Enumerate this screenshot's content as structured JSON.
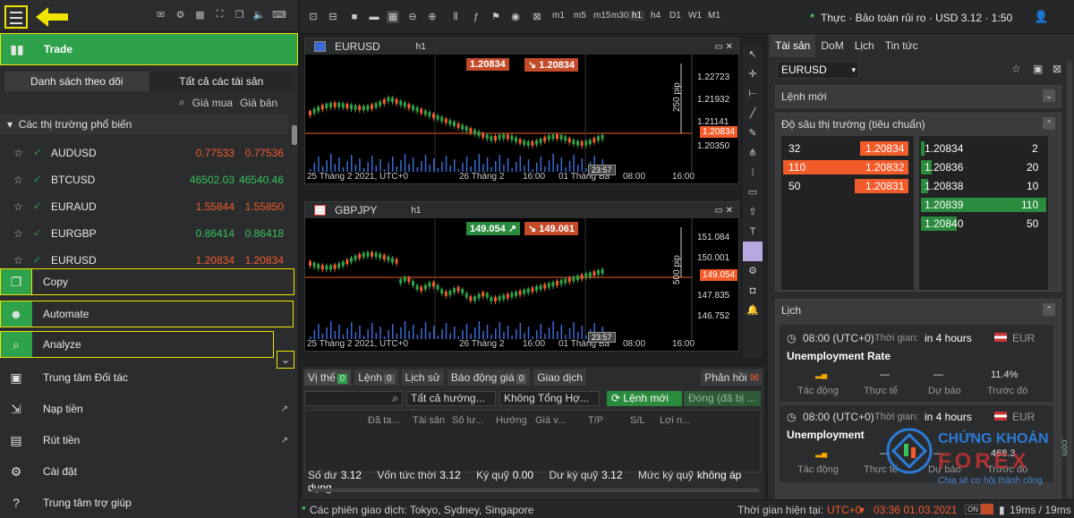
{
  "sidebar": {
    "trade": "Trade",
    "tabs": [
      "Danh sách theo dõi",
      "Tất cả các tài sản"
    ],
    "cols": {
      "bid": "Giá mua",
      "ask": "Giá bán"
    },
    "group": "Các thị trường phổ biến",
    "symbols": [
      {
        "name": "AUDUSD",
        "bid": "0.77533",
        "ask": "0.77536",
        "bidc": "red",
        "askc": "red"
      },
      {
        "name": "BTCUSD",
        "bid": "46502.03",
        "ask": "46540.46",
        "bidc": "grn",
        "askc": "grn"
      },
      {
        "name": "EURAUD",
        "bid": "1.55844",
        "ask": "1.55850",
        "bidc": "red",
        "askc": "red"
      },
      {
        "name": "EURGBP",
        "bid": "0.86414",
        "ask": "0.86418",
        "bidc": "grn",
        "askc": "grn"
      },
      {
        "name": "EURUSD",
        "bid": "1.20834",
        "ask": "1.20834",
        "bidc": "red",
        "askc": "red"
      }
    ],
    "menu": {
      "copy": "Copy",
      "automate": "Automate",
      "analyze": "Analyze",
      "partner": "Trung tâm Đối tác",
      "deposit": "Nạp tiền",
      "withdraw": "Rút tiền",
      "settings": "Cài đặt",
      "help": "Trung tâm trợ giúp"
    }
  },
  "toolbar": {
    "timeframes": [
      "m1",
      "m5",
      "m15",
      "m30",
      "h1",
      "h4",
      "D1",
      "W1",
      "M1"
    ],
    "account": "Thực · Bảo toàn rủi ro · USD 3.12 · 1:50"
  },
  "chart1": {
    "symbol": "EURUSD",
    "tf": "h1",
    "sell": "1.20834",
    "buy": "1.20834",
    "prices": [
      "1.22723",
      "1.21932",
      "1.21141",
      "1.20834",
      "1.20350"
    ],
    "pips": "250 pip",
    "times": [
      "25 Tháng 2 2021, UTC+0",
      "26 Tháng 2",
      "16:00",
      "01 Tháng Ba",
      "08:00",
      "16:00"
    ],
    "clock": "23:57"
  },
  "chart2": {
    "symbol": "GBPJPY",
    "tf": "h1",
    "sell": "149.054",
    "buy": "149.061",
    "prices": [
      "151.084",
      "150.001",
      "149.054",
      "147.835",
      "146.752"
    ],
    "pips": "500 pip",
    "times": [
      "25 Tháng 2 2021, UTC+0",
      "26 Tháng 2",
      "16:00",
      "01 Tháng Ba",
      "08:00",
      "16:00"
    ],
    "clock": "23:57"
  },
  "positions": {
    "tabs": [
      {
        "l": "Vị thế",
        "c": "0"
      },
      {
        "l": "Lệnh",
        "c": "0"
      },
      {
        "l": "Lịch sử",
        "c": ""
      },
      {
        "l": "Báo động giá",
        "c": "0"
      },
      {
        "l": "Giao dịch",
        "c": ""
      }
    ],
    "feedback": "Phản hồi",
    "dir": "Tất cả hướng...",
    "type": "Không Tổng Hợ...",
    "new": "Lệnh mới",
    "close": "Đóng (đã bị ...",
    "cols": [
      "Đã ta...",
      "Tài sản",
      "Số lư...",
      "Hướng",
      "Giá v...",
      "T/P",
      "S/L",
      "Lợi n..."
    ],
    "summary": [
      {
        "l": "Số dư",
        "v": "3.12"
      },
      {
        "l": "Vốn tức thời",
        "v": "3.12"
      },
      {
        "l": "Ký quỹ",
        "v": "0.00"
      },
      {
        "l": "Dư ký quỹ",
        "v": "3.12"
      },
      {
        "l": "Mức ký quỹ",
        "v": "không áp dụng"
      }
    ]
  },
  "right": {
    "tabs": [
      "Tài sản",
      "DoM",
      "Lịch",
      "Tin tức"
    ],
    "instrument": "EURUSD",
    "new_order": "Lệnh mới",
    "depth": "Độ sâu thị trường (tiêu chuẩn)",
    "bids": [
      {
        "vol": "32",
        "price": "1.20834"
      },
      {
        "vol": "110",
        "price": "1.20832"
      },
      {
        "vol": "50",
        "price": "1.20831"
      }
    ],
    "asks": [
      {
        "price": "1.20834",
        "vol": "2"
      },
      {
        "price": "1.20836",
        "vol": "20"
      },
      {
        "price": "1.20838",
        "vol": "10"
      },
      {
        "price": "1.20839",
        "vol": "110"
      },
      {
        "price": "1.20840",
        "vol": "50"
      }
    ],
    "calendar": "Lịch",
    "events": [
      {
        "time": "08:00 (UTC+0)",
        "tlabel": "Thời gian:",
        "in": "in 4 hours",
        "cur": "EUR",
        "title": "Unemployment Rate",
        "labels": [
          "Tác động",
          "Thực tế",
          "Dự báo",
          "Trước đó"
        ],
        "values": [
          "",
          "—",
          "—",
          "11.4%"
        ]
      },
      {
        "time": "08:00 (UTC+0)",
        "tlabel": "Thời gian:",
        "in": "in 4 hours",
        "cur": "EUR",
        "title": "Unemployment",
        "labels": [
          "Tác động",
          "Thực tế",
          "Dự báo",
          "Trước đó"
        ],
        "values": [
          "",
          "—",
          "—",
          "468.3"
        ]
      }
    ]
  },
  "status": {
    "sessions": "Các phiên giao dịch: Tokyo, Sydney, Singapore",
    "now_label": "Thời gian hiện tại:",
    "tz": "UTC+0",
    "clock": "03:36 01.03.2021",
    "on": "ON",
    "latency": "19ms / 19ms"
  },
  "watermark": {
    "line1": "CHỨNG KHOÁN",
    "line2": "FOREX",
    "line3": "Chia sẻ cơ hội thành công",
    "dotcom": ".com"
  }
}
